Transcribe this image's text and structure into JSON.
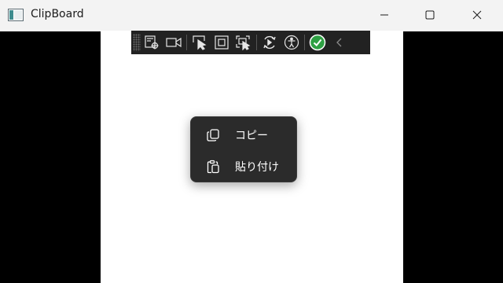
{
  "window": {
    "title": "ClipBoard",
    "icon": "app-window-icon",
    "controls": [
      "minimize-icon",
      "maximize-icon",
      "close-icon"
    ]
  },
  "dev_toolbar": {
    "icons": [
      "live-visual-tree-icon",
      "camera-icon",
      "select-element-icon",
      "display-layout-adorners-icon",
      "track-focused-element-icon",
      "hot-reload-icon",
      "accessibility-icon",
      "check-status-icon",
      "collapse-chevron-icon"
    ],
    "status_color": "#2ea043"
  },
  "context_menu": {
    "items": [
      {
        "label": "コピー",
        "icon": "copy-icon"
      },
      {
        "label": "貼り付け",
        "icon": "paste-icon"
      }
    ]
  }
}
